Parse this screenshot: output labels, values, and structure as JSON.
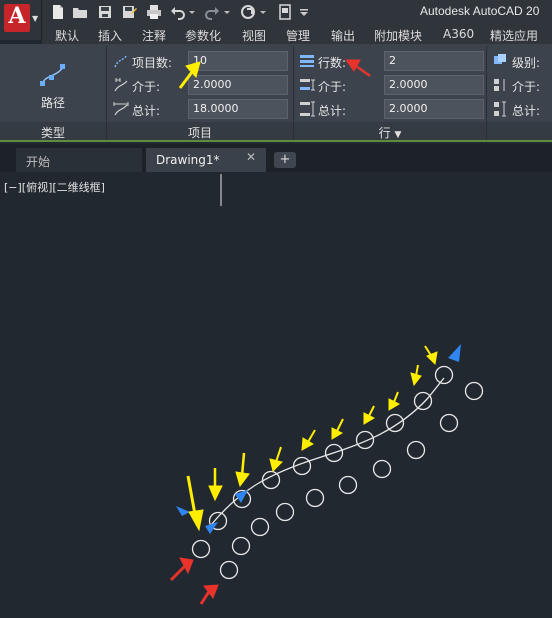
{
  "title_bar": {
    "app_logo_letter": "A",
    "app_title": "Autodesk AutoCAD 20"
  },
  "ribbon_tabs": [
    "默认",
    "插入",
    "注释",
    "参数化",
    "视图",
    "管理",
    "输出",
    "附加模块",
    "A360",
    "精选应用"
  ],
  "ribbon": {
    "type_panel": {
      "button_label": "路径",
      "panel_title": "类型"
    },
    "items_panel": {
      "panel_title": "项目",
      "rows": [
        {
          "label": "项目数:",
          "value": "10"
        },
        {
          "label": "介于:",
          "value": "2.0000"
        },
        {
          "label": "总计:",
          "value": "18.0000"
        }
      ]
    },
    "rows_panel": {
      "panel_title": "行",
      "panel_title_caret": "▼",
      "rows": [
        {
          "label": "行数:",
          "value": "2"
        },
        {
          "label": "介于:",
          "value": "2.0000"
        },
        {
          "label": "总计:",
          "value": "2.0000"
        }
      ]
    },
    "levels_panel": {
      "rows": [
        {
          "label": "级别:"
        },
        {
          "label": "介于:"
        },
        {
          "label": "总计:"
        }
      ]
    }
  },
  "doc_tabs": {
    "start_label": "开始",
    "drawing_label": "Drawing1*",
    "close_glyph": "✕",
    "new_tab_glyph": "+"
  },
  "canvas": {
    "viewport_label": "[−][俯视][二维线框]"
  },
  "colors": {
    "annotation_yellow": "#ffee00",
    "annotation_red": "#e8332b",
    "grip_blue": "#2f86f0",
    "array_white": "#e8e8e8"
  }
}
